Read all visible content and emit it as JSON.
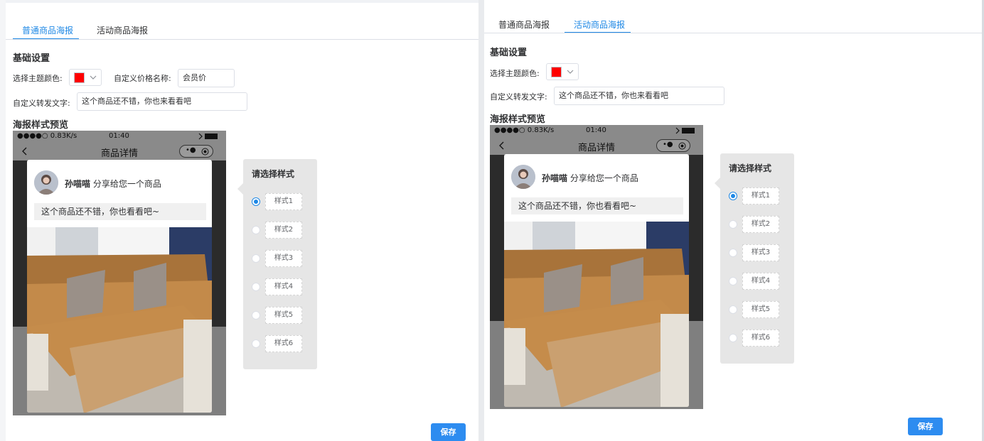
{
  "left": {
    "tabs": [
      {
        "label": "普通商品海报",
        "active": true
      },
      {
        "label": "活动商品海报",
        "active": false
      }
    ],
    "basic_settings": "基础设置",
    "theme_color_label": "选择主题颜色:",
    "theme_color": "#ff0000",
    "price_name_label": "自定义价格名称:",
    "price_name_value": "会员价",
    "share_text_label": "自定义转发文字:",
    "share_text_value": "这个商品还不错，你也来看看吧",
    "preview_title": "海报样式预览",
    "phone": {
      "status_left": "●●●●○ 0.83K/s",
      "time": "01:40",
      "nav_title": "商品详情"
    },
    "card": {
      "user": "孙喵喵",
      "share_line": "分享给您一个商品",
      "message": "这个商品还不错，你也看看吧~"
    },
    "style_panel": {
      "title": "请选择样式",
      "options": [
        "样式1",
        "样式2",
        "样式3",
        "样式4",
        "样式5",
        "样式6"
      ],
      "selected": 0
    },
    "save": "保存"
  },
  "right": {
    "tabs": [
      {
        "label": "普通商品海报",
        "active": false
      },
      {
        "label": "活动商品海报",
        "active": true
      }
    ],
    "basic_settings": "基础设置",
    "theme_color_label": "选择主题颜色:",
    "theme_color": "#ff0000",
    "share_text_label": "自定义转发文字:",
    "share_text_value": "这个商品还不错，你也来看看吧",
    "preview_title": "海报样式预览",
    "phone": {
      "status_left": "●●●●○ 0.83K/s",
      "time": "01:40",
      "nav_title": "商品详情"
    },
    "card": {
      "user": "孙喵喵",
      "share_line": "分享给您一个商品",
      "message": "这个商品还不错，你也看看吧~"
    },
    "style_panel": {
      "title": "请选择样式",
      "options": [
        "样式1",
        "样式2",
        "样式3",
        "样式4",
        "样式5",
        "样式6"
      ],
      "selected": 0
    },
    "save": "保存"
  }
}
